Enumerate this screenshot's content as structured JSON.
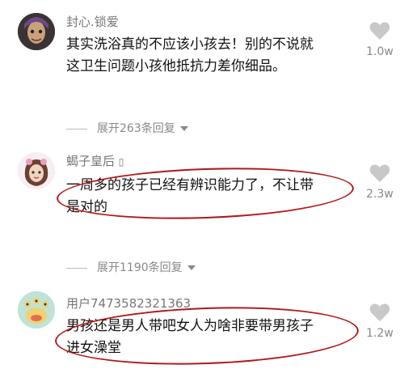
{
  "comments": [
    {
      "username": "封心.锁爱",
      "text_line1": "其实洗浴真的不应该小孩去！别的不说就",
      "text_line2": "这卫生问题小孩他抵抗力差你细品。",
      "likes": "1.0w"
    },
    {
      "username": "蝎子皇后",
      "username_suffix": "▯",
      "text_line1": "一周多的孩子已经有辨识能力了，不让带",
      "text_line2": "是对的",
      "likes": "2.3w"
    },
    {
      "username": "用户7473582321363",
      "text_line1": "男孩还是男人带吧女人为啥非要带男孩子",
      "text_line2": "进女澡堂",
      "likes": "1.2w"
    }
  ],
  "expand_replies": [
    {
      "label": "展开263条回复"
    },
    {
      "label": "展开1190条回复"
    }
  ],
  "icons": {
    "like": "heart-icon",
    "expand": "chevron-down-icon"
  },
  "colors": {
    "annotation_circle": "#b21818",
    "meta_text": "#888888"
  }
}
